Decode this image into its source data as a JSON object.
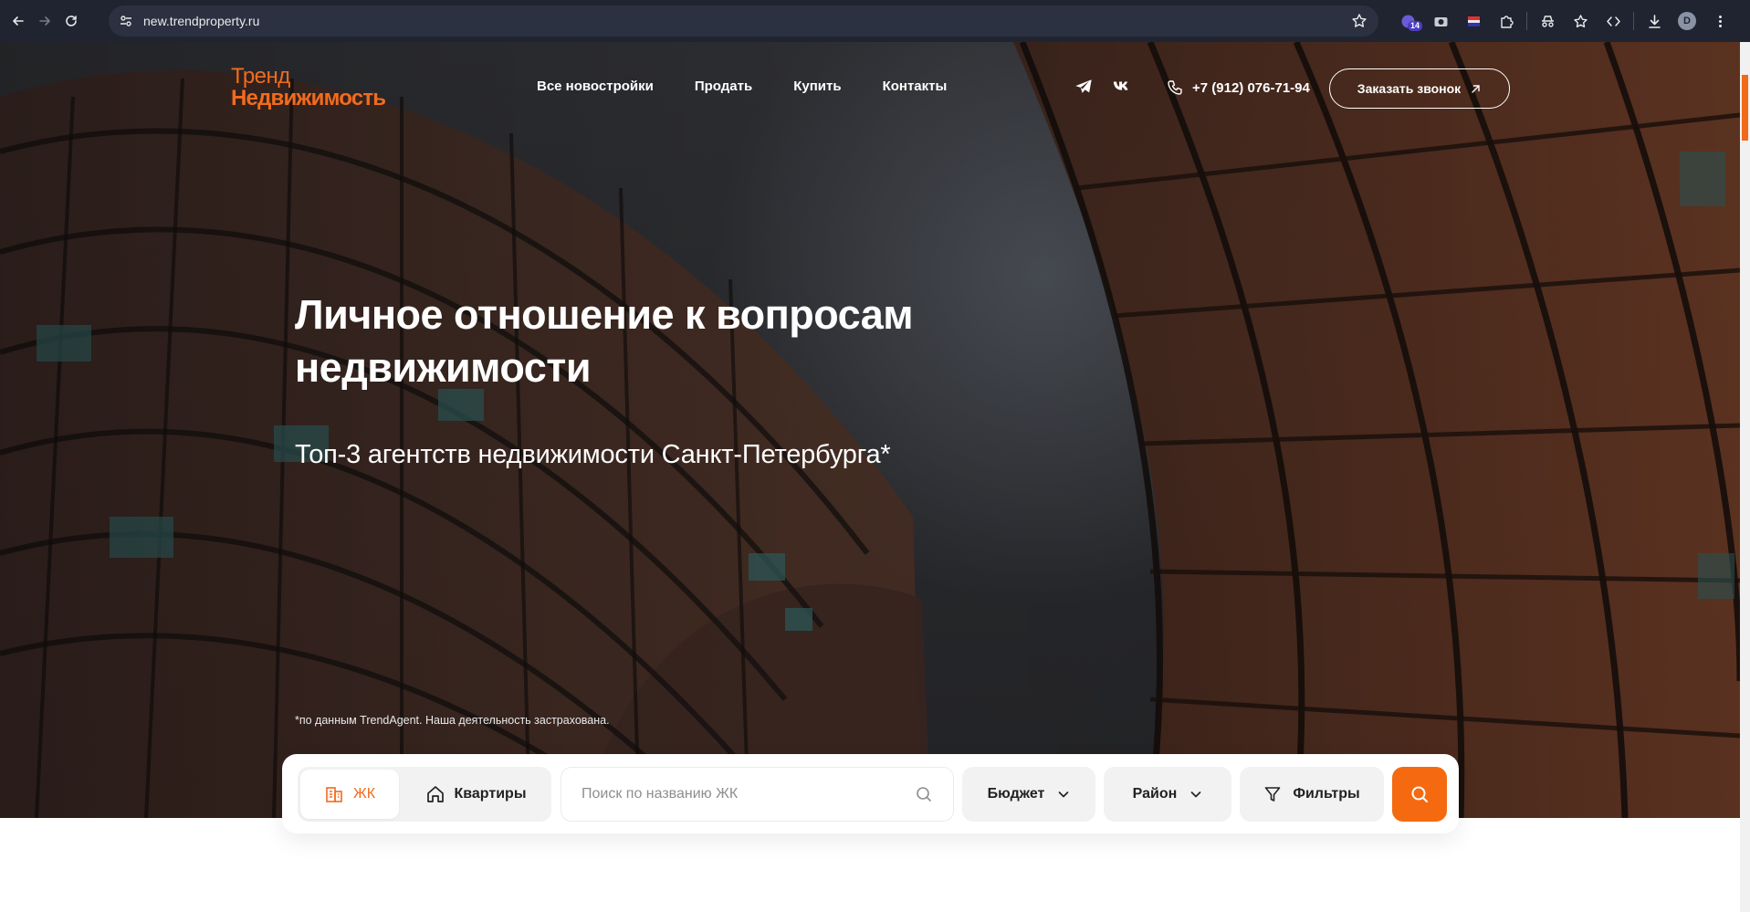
{
  "browser": {
    "url": "new.trendproperty.ru",
    "extension_badge": "14",
    "profile_initial": "D",
    "icons": [
      "back-icon",
      "forward-icon",
      "reload-icon",
      "site-info-icon",
      "bookmark-star-icon",
      "extension-icon",
      "camera-icon",
      "flag-icon",
      "puzzle-icon",
      "incognito-icon",
      "star-list-icon",
      "code-icon",
      "download-icon",
      "menu-dots-icon"
    ]
  },
  "site": {
    "logo_line1": "Тренд",
    "logo_line2": "Недвижимость",
    "accent_color": "#f26b1d",
    "nav": [
      {
        "label": "Все новостройки"
      },
      {
        "label": "Продать"
      },
      {
        "label": "Купить"
      },
      {
        "label": "Контакты"
      }
    ],
    "social_icons": [
      "telegram-icon",
      "vk-icon"
    ],
    "phone": "+7 (912) 076-71-94",
    "callback_label": "Заказать звонок"
  },
  "hero": {
    "title": "Личное отношение к вопросам недвижимости",
    "subtitle": "Топ-3 агентств недвижимости Санкт-Петербурга*",
    "note": "*по данным TrendAgent. Наша деятельность застрахована."
  },
  "search": {
    "tabs": [
      {
        "label": "ЖК",
        "active": true
      },
      {
        "label": "Квартиры",
        "active": false
      }
    ],
    "input_placeholder": "Поиск по названию ЖК",
    "input_value": "",
    "budget_label": "Бюджет",
    "district_label": "Район",
    "filters_label": "Фильтры"
  }
}
